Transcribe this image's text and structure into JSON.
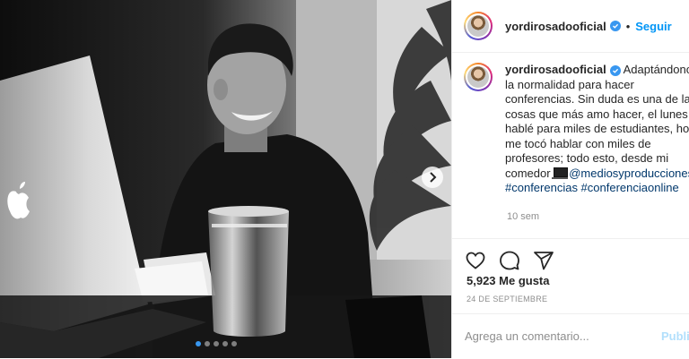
{
  "post": {
    "username": "yordirosadooficial",
    "follow_label": "Seguir",
    "bullet": "•",
    "caption_lines": [
      "Adaptándonos a",
      "la normalidad para hacer",
      "conferencias. Sin duda es una de las",
      "cosas que más amo hacer, el lunes",
      "hablé para miles de estudiantes, hoy",
      "me tocó hablar con miles de",
      "profesores; todo esto, desde mi"
    ],
    "caption_comedor": "comedor",
    "mention": "@mediosyproducciones",
    "hashtags": "#conferencias #conferenciaonline",
    "time_ago": "10 sem",
    "likes": "5,923 Me gusta",
    "date": "24 DE SEPTIEMBRE",
    "comment_placeholder": "Agrega un comentario...",
    "publish_label": "Publicar",
    "carousel": {
      "slides": 5,
      "active": 1
    }
  },
  "icons": {
    "verified": "verified-badge-icon",
    "like": "heart-icon",
    "comment": "comment-bubble-icon",
    "share": "paper-plane-icon",
    "carousel_next": "chevron-right-icon",
    "logo": "apple-logo-icon"
  },
  "colors": {
    "link_blue": "#0095f6",
    "verified_blue": "#3897f0",
    "hashtag": "#00376b",
    "muted": "#8e8e8e",
    "publish_disabled": "#b2dffc"
  }
}
